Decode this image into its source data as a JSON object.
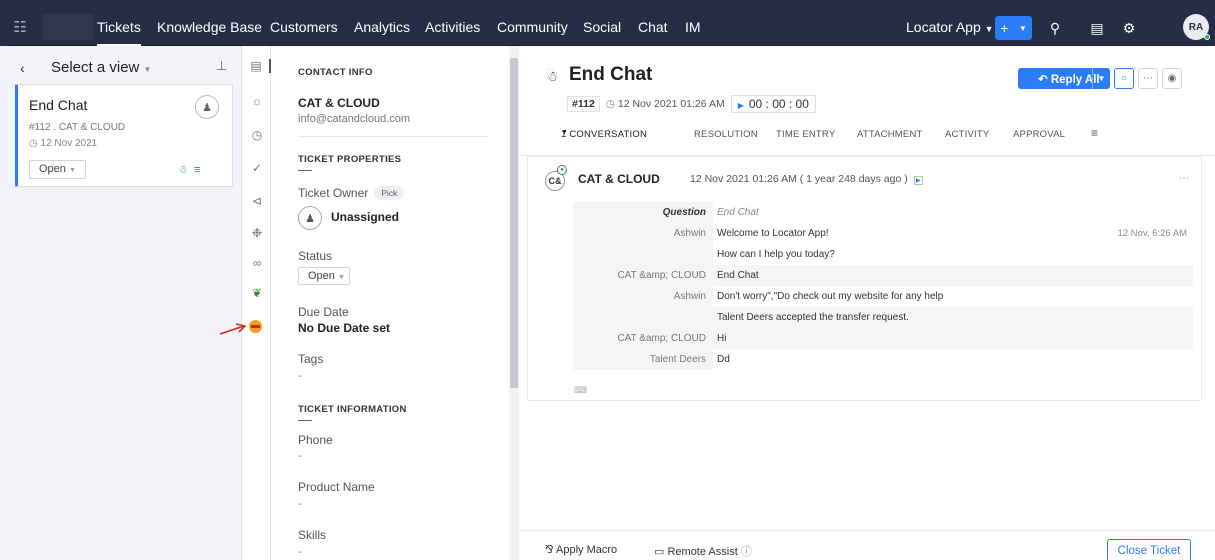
{
  "topnav": {
    "items": [
      "Tickets",
      "Knowledge Base",
      "Customers",
      "Analytics",
      "Activities",
      "Community",
      "Social",
      "Chat",
      "IM"
    ],
    "app_selector": "Locator App",
    "avatar_initials": "RA"
  },
  "left": {
    "select_view": "Select a view",
    "ticket": {
      "title": "End Chat",
      "id_line": "#112 . CAT & CLOUD",
      "date_line": "12 Nov 2021",
      "status": "Open"
    }
  },
  "props": {
    "contact_info": "CONTACT INFO",
    "contact_name": "CAT & CLOUD",
    "contact_email": "info@catandcloud.com",
    "ticket_properties": "TICKET PROPERTIES",
    "ticket_owner_label": "Ticket Owner",
    "pick_label": "Pick",
    "owner_value": "Unassigned",
    "status_label": "Status",
    "status_value": "Open",
    "due_label": "Due Date",
    "due_value": "No Due Date set",
    "tags_label": "Tags",
    "tags_value": "-",
    "ticket_information": "TICKET INFORMATION",
    "phone_label": "Phone",
    "phone_value": "-",
    "product_label": "Product Name",
    "product_value": "-",
    "skills_label": "Skills",
    "skills_value": "-"
  },
  "main": {
    "title": "End Chat",
    "id": "#112",
    "created": "12 Nov 2021 01:26 AM",
    "timer": "00 : 00 : 00",
    "reply_all": "Reply All",
    "tabs": [
      "1 CONVERSATION",
      "RESOLUTION",
      "TIME ENTRY",
      "ATTACHMENT",
      "ACTIVITY",
      "APPROVAL"
    ],
    "conversation": {
      "avatar": "C&",
      "name": "CAT & CLOUD",
      "when": "12 Nov 2021 01:26 AM ( 1 year 248 days ago )",
      "rows": [
        {
          "who": "Question",
          "msg": "End Chat",
          "time": ""
        },
        {
          "who": "Ashwin",
          "msg": "Welcome to Locator App!",
          "time": "12 Nov, 6:26 AM"
        },
        {
          "who": "",
          "msg": "How can I help you today?",
          "time": ""
        },
        {
          "who": "CAT &amp; CLOUD",
          "msg": "End Chat",
          "time": ""
        },
        {
          "who": "Ashwin",
          "msg": "Don't worry\",\"Do check out my website for any help",
          "time": ""
        },
        {
          "who": "",
          "msg": "Talent Deers accepted the transfer request.",
          "time": ""
        },
        {
          "who": "CAT &amp; CLOUD",
          "msg": "Hi",
          "time": ""
        },
        {
          "who": "Talent Deers",
          "msg": "Dd",
          "time": ""
        }
      ]
    }
  },
  "footer": {
    "apply_macro": "Apply Macro",
    "remote_assist": "Remote Assist",
    "close_ticket": "Close Ticket"
  },
  "colors": {
    "accent": "#2b7cf7",
    "topbar": "#252c43",
    "green": "#2b8f3b"
  }
}
